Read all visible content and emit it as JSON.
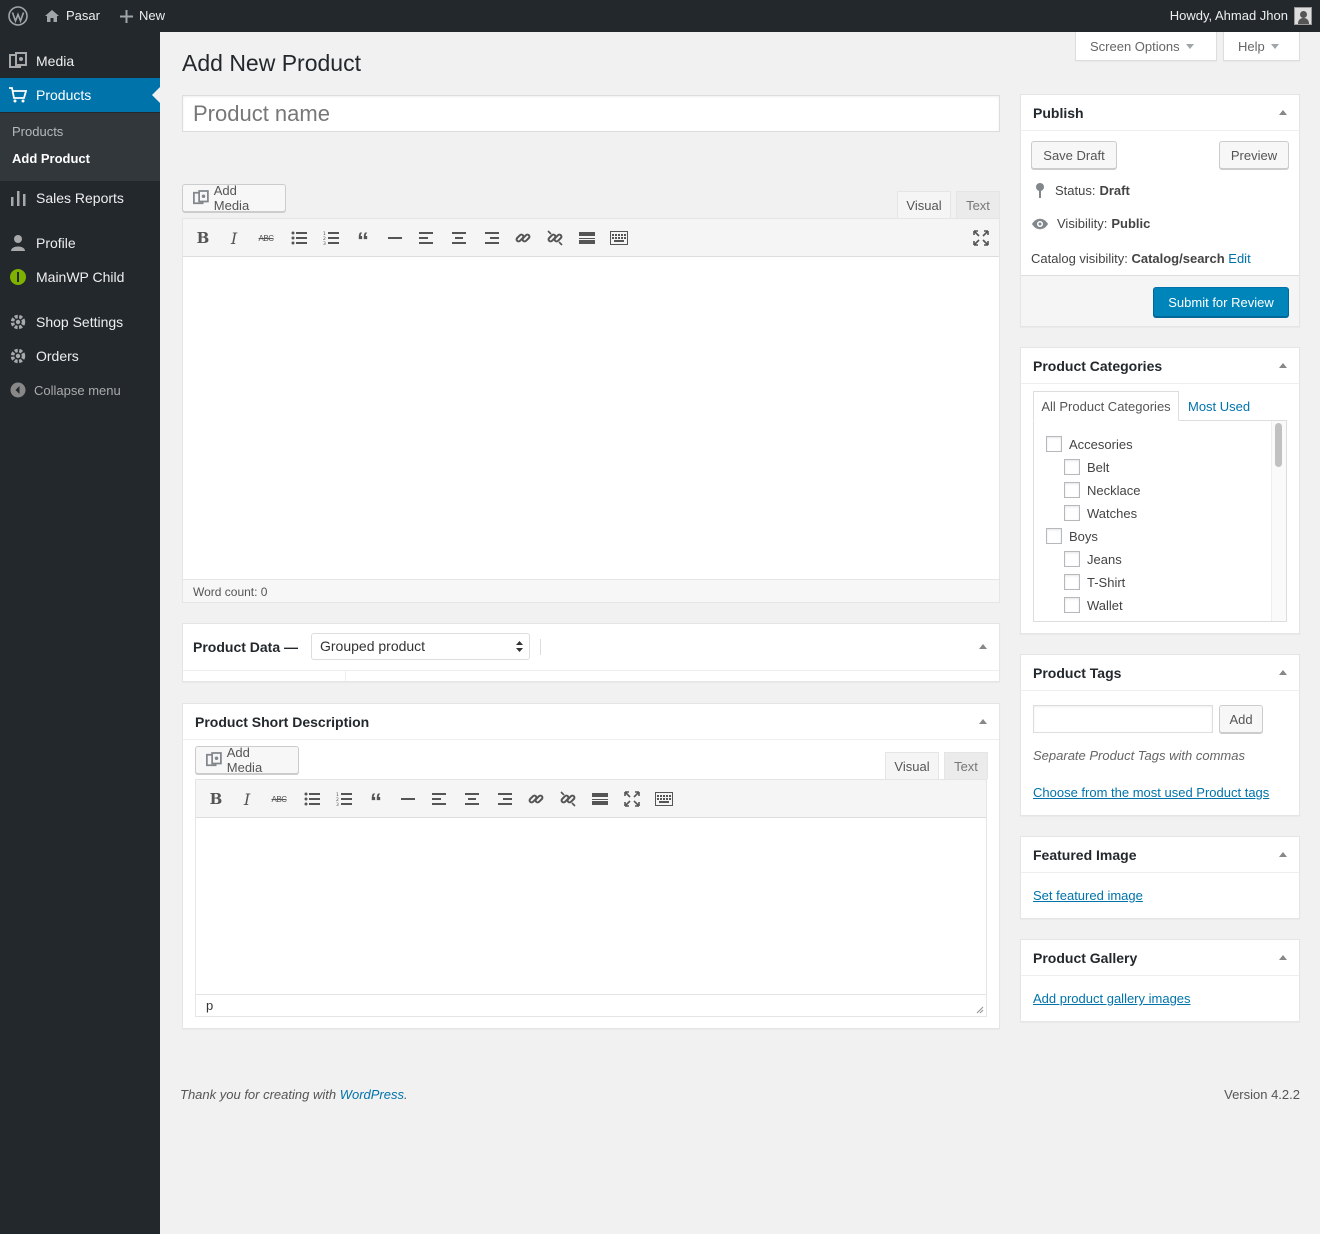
{
  "admin_bar": {
    "site_name": "Pasar",
    "new_label": "New",
    "howdy": "Howdy, Ahmad Jhon"
  },
  "sidebar": {
    "items": [
      {
        "label": "Media",
        "icon": "media-icon"
      },
      {
        "label": "Products",
        "icon": "cart-icon"
      },
      {
        "label": "Sales Reports",
        "icon": "chart-bar-icon"
      },
      {
        "label": "Profile",
        "icon": "person-icon"
      },
      {
        "label": "MainWP Child",
        "icon": "mainwp-icon"
      },
      {
        "label": "Shop Settings",
        "icon": "gear-icon"
      },
      {
        "label": "Orders",
        "icon": "gear-icon"
      }
    ],
    "submenu": [
      "Products",
      "Add Product"
    ],
    "collapse_label": "Collapse menu"
  },
  "header": {
    "screen_options": "Screen Options",
    "help": "Help",
    "page_title": "Add New Product"
  },
  "title_field": {
    "placeholder": "Product name",
    "value": ""
  },
  "main_editor": {
    "add_media": "Add Media",
    "tab_visual": "Visual",
    "tab_text": "Text",
    "word_count": "Word count: 0"
  },
  "product_data": {
    "label": "Product Data —",
    "type_selected": "Grouped product"
  },
  "short_description": {
    "title": "Product Short Description",
    "add_media": "Add Media",
    "tab_visual": "Visual",
    "tab_text": "Text",
    "path": "p"
  },
  "publish": {
    "title": "Publish",
    "save_draft": "Save Draft",
    "preview": "Preview",
    "status_label": "Status:",
    "status_value": "Draft",
    "visibility_label": "Visibility:",
    "visibility_value": "Public",
    "catalog_label": "Catalog visibility:",
    "catalog_value": "Catalog/search",
    "catalog_edit": "Edit",
    "submit": "Submit for Review"
  },
  "categories": {
    "title": "Product Categories",
    "tab_all": "All Product Categories",
    "tab_most_used": "Most Used",
    "items": [
      {
        "label": "Accesories",
        "level": 0
      },
      {
        "label": "Belt",
        "level": 1
      },
      {
        "label": "Necklace",
        "level": 1
      },
      {
        "label": "Watches",
        "level": 1
      },
      {
        "label": "Boys",
        "level": 0
      },
      {
        "label": "Jeans",
        "level": 1
      },
      {
        "label": "T-Shirt",
        "level": 1
      },
      {
        "label": "Wallet",
        "level": 1
      }
    ]
  },
  "tags": {
    "title": "Product Tags",
    "add": "Add",
    "hint": "Separate Product Tags with commas",
    "choose_link": "Choose from the most used Product tags"
  },
  "featured_image": {
    "title": "Featured Image",
    "link": "Set featured image"
  },
  "gallery": {
    "title": "Product Gallery",
    "link": "Add product gallery images"
  },
  "footer": {
    "thanks_prefix": "Thank you for creating with ",
    "thanks_link": "WordPress",
    "thanks_suffix": ".",
    "version": "Version 4.2.2"
  },
  "colors": {
    "accent": "#0073aa",
    "sidebar_bg": "#23282d",
    "primary_button": "#0085ba"
  }
}
